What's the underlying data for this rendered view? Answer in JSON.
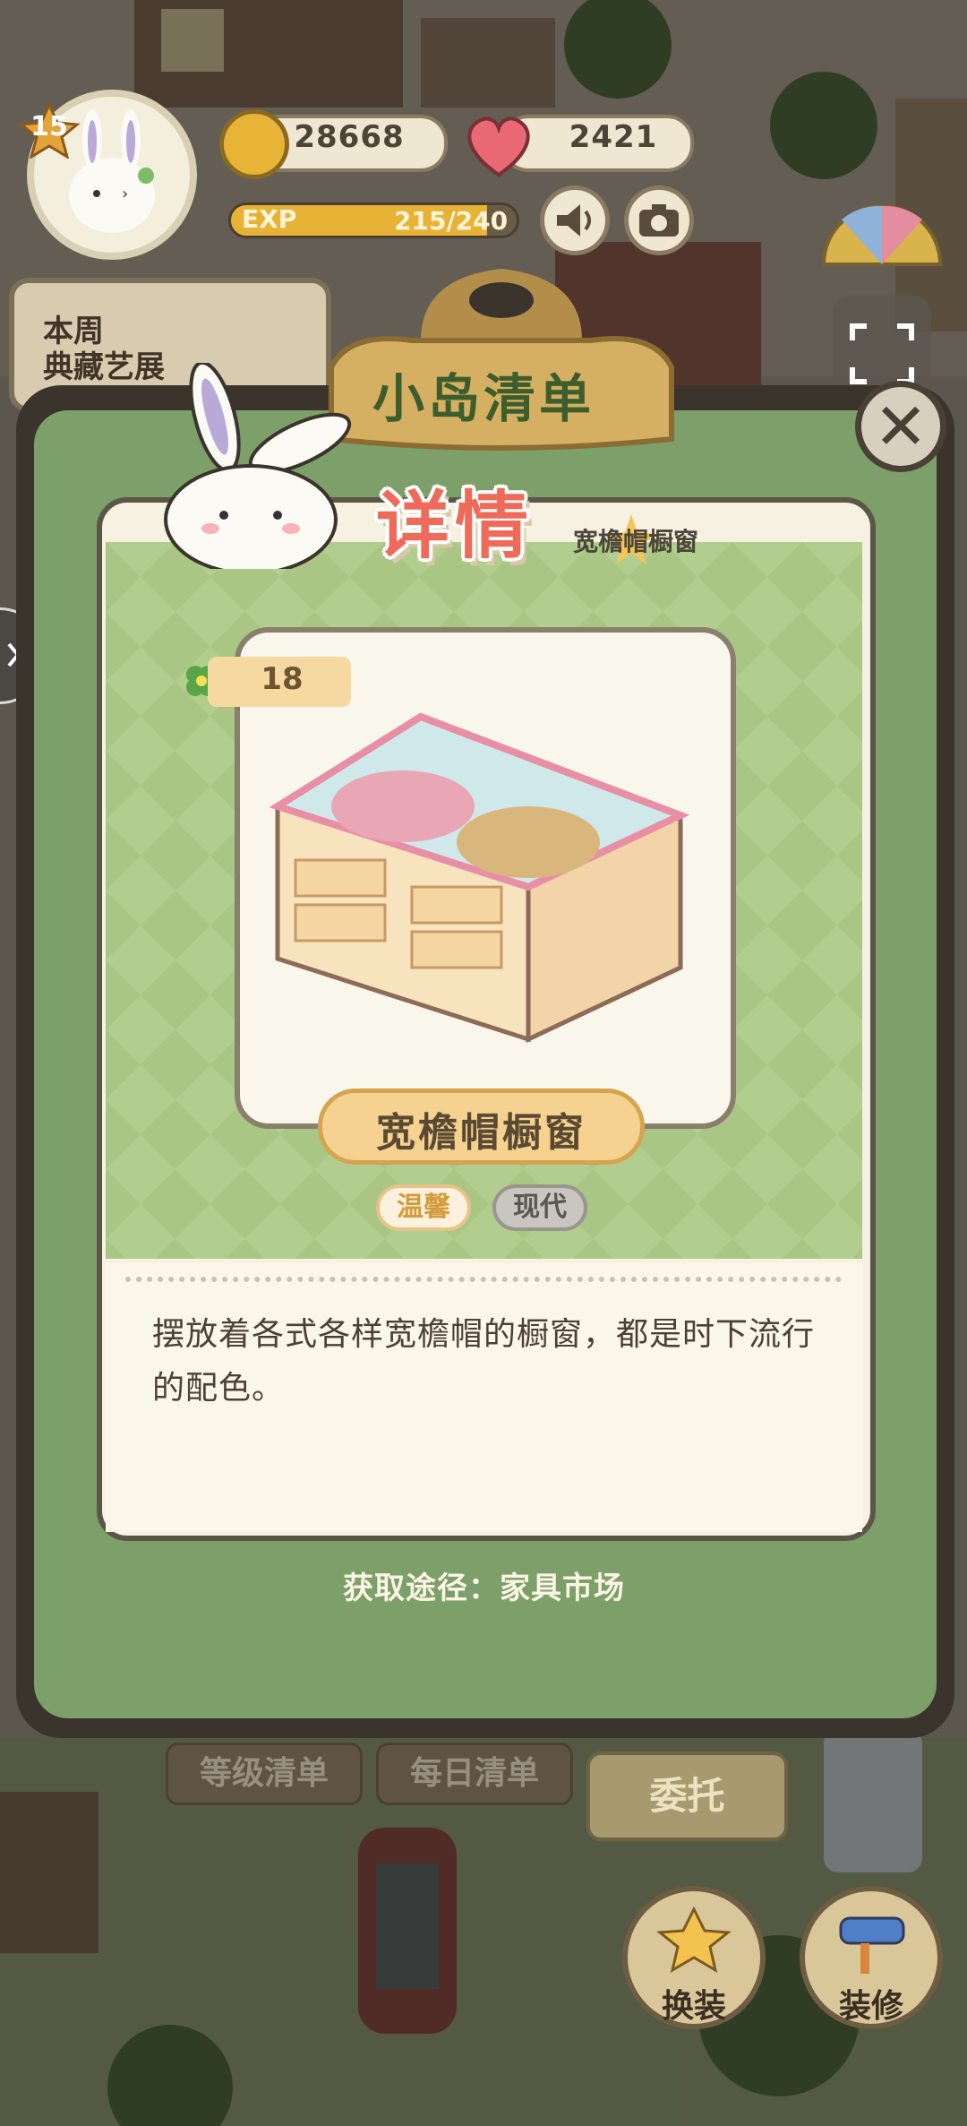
{
  "hud": {
    "level": "15",
    "coins": "28668",
    "hearts": "2421",
    "exp_label": "EXP",
    "exp_current": "215",
    "exp_max": "240",
    "exp_value_text": "215/240",
    "exp_fraction": 0.896,
    "weekly_banner_line1": "本周",
    "weekly_banner_line2": "典藏艺展"
  },
  "list_panel": {
    "title": "小岛清单",
    "close_glyph": "✕"
  },
  "detail": {
    "title": "详情",
    "behind_name_hint": "宽檐帽橱窗",
    "score": "18",
    "item_name": "宽檐帽橱窗",
    "tags": [
      "温馨",
      "现代"
    ],
    "description": "摆放着各式各样宽檐帽的橱窗，都是时下流行的配色。",
    "source": "获取途径：家具市场"
  },
  "bottom": {
    "level_list": "等级清单",
    "daily_list": "每日清单",
    "entrust": "委托",
    "dress_up": "换装",
    "renovate": "装修"
  },
  "icons": {
    "coin": "rabbit-coin-icon",
    "heart": "heart-icon",
    "speaker": "speaker-icon",
    "camera": "camera-icon",
    "expand": "fullscreen-icon",
    "clover": "clover-icon",
    "close": "close-icon"
  },
  "colors": {
    "detail_title": "#ef6b59",
    "panel_green": "#b2ce8e",
    "name_plate": "#f5d28f"
  }
}
